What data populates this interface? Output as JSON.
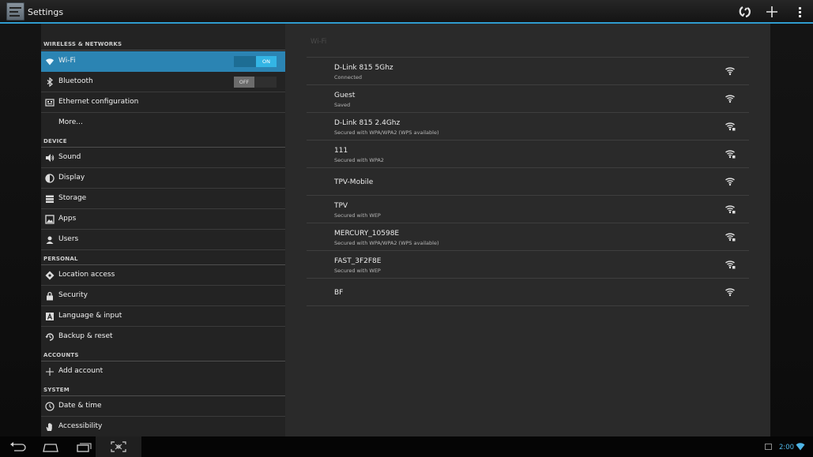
{
  "app": {
    "title": "Settings"
  },
  "colors": {
    "accent": "#33b5e5",
    "selected_bg": "#2b84b3"
  },
  "actionbar": {
    "icons": [
      "wps-icon",
      "add-network-icon",
      "overflow-menu-icon"
    ]
  },
  "sidebar": {
    "headers": {
      "wireless": "WIRELESS & NETWORKS",
      "device": "DEVICE",
      "personal": "PERSONAL",
      "accounts": "ACCOUNTS",
      "system": "SYSTEM"
    },
    "items": [
      {
        "label": "Wi-Fi",
        "icon": "wifi-icon",
        "toggle": "ON",
        "selected": true
      },
      {
        "label": "Bluetooth",
        "icon": "bluetooth-icon",
        "toggle": "OFF"
      },
      {
        "label": "Ethernet configuration",
        "icon": "ethernet-icon"
      },
      {
        "label": "More...",
        "icon": ""
      },
      {
        "label": "Sound",
        "icon": "speaker-icon"
      },
      {
        "label": "Display",
        "icon": "display-icon"
      },
      {
        "label": "Storage",
        "icon": "storage-icon"
      },
      {
        "label": "Apps",
        "icon": "apps-icon"
      },
      {
        "label": "Users",
        "icon": "users-icon"
      },
      {
        "label": "Location access",
        "icon": "location-icon"
      },
      {
        "label": "Security",
        "icon": "lock-icon"
      },
      {
        "label": "Language & input",
        "icon": "language-icon"
      },
      {
        "label": "Backup & reset",
        "icon": "backup-icon"
      },
      {
        "label": "Add account",
        "icon": "plus-icon"
      },
      {
        "label": "Date & time",
        "icon": "clock-icon"
      },
      {
        "label": "Accessibility",
        "icon": "hand-icon"
      }
    ]
  },
  "wifi_panel": {
    "title": "Wi-Fi",
    "networks": [
      {
        "ssid": "D-Link 815 5Ghz",
        "status": "Connected",
        "secured": false
      },
      {
        "ssid": "Guest",
        "status": "Saved",
        "secured": false
      },
      {
        "ssid": "D-Link 815 2.4Ghz",
        "status": "Secured with WPA/WPA2 (WPS available)",
        "secured": true
      },
      {
        "ssid": "111",
        "status": "Secured with WPA2",
        "secured": true
      },
      {
        "ssid": "TPV-Mobile",
        "status": "",
        "secured": false
      },
      {
        "ssid": "TPV",
        "status": "Secured with WEP",
        "secured": true
      },
      {
        "ssid": "MERCURY_10598E",
        "status": "Secured with WPA/WPA2 (WPS available)",
        "secured": true
      },
      {
        "ssid": "FAST_3F2F8E",
        "status": "Secured with WEP",
        "secured": true
      },
      {
        "ssid": "BF",
        "status": "",
        "secured": false
      }
    ]
  },
  "navbar": {
    "buttons": [
      "back-icon",
      "home-icon",
      "recent-apps-icon",
      "screenshot-icon"
    ],
    "clock": "2:00"
  }
}
